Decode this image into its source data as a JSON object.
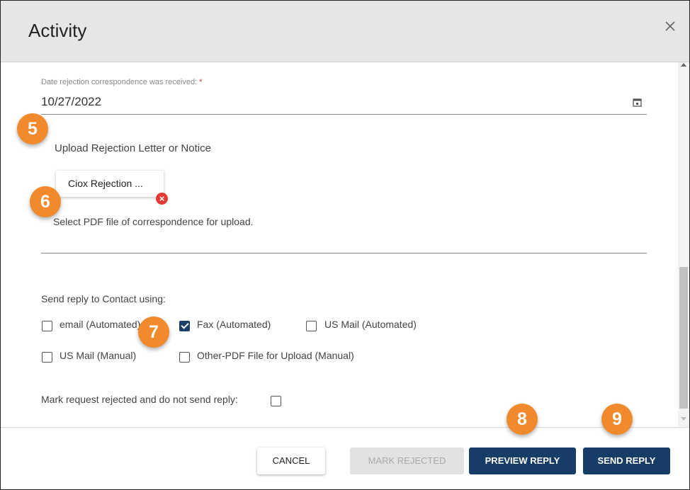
{
  "dialog": {
    "title": "Activity"
  },
  "form": {
    "date_label": "Date rejection correspondence was received:",
    "required_marker": "*",
    "date_value": "10/27/2022",
    "upload_label": "Upload Rejection Letter or Notice",
    "file_chip": "Ciox Rejection ...",
    "file_hint": "Select PDF file of correspondence for upload.",
    "send_label": "Send reply to Contact using:",
    "options": [
      {
        "label": "email (Automated)",
        "checked": false
      },
      {
        "label": "Fax (Automated)",
        "checked": true
      },
      {
        "label": "US Mail (Automated)",
        "checked": false
      },
      {
        "label": "US Mail (Manual)",
        "checked": false
      },
      {
        "label": "Other-PDF File for Upload (Manual)",
        "checked": false
      }
    ],
    "mark_rejected_label": "Mark request rejected and do not send reply:",
    "mark_rejected_checked": false
  },
  "footer": {
    "cancel": "CANCEL",
    "mark_rejected": "MARK REJECTED",
    "preview_reply": "PREVIEW REPLY",
    "send_reply": "SEND REPLY"
  },
  "callouts": [
    "5",
    "6",
    "7",
    "8",
    "9"
  ],
  "colors": {
    "primary": "#173d66",
    "callout": "#f08a2c",
    "remove": "#e53935"
  },
  "icons": {
    "close": "close-icon",
    "calendar": "calendar-icon",
    "remove": "remove-file-icon"
  }
}
